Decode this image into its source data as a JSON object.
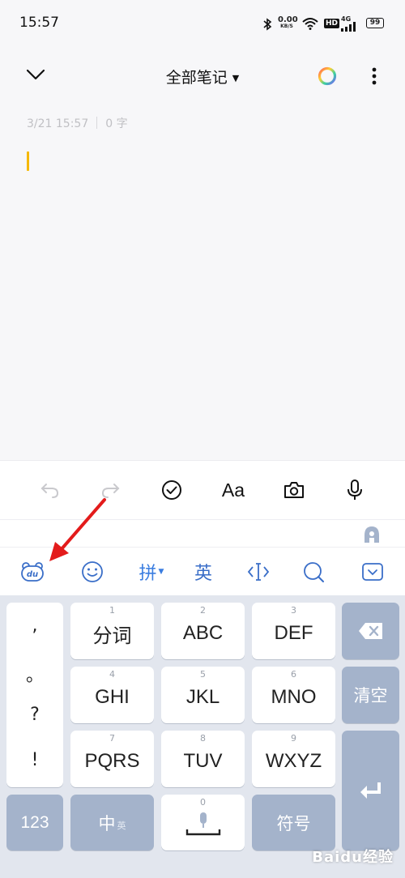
{
  "status_bar": {
    "time": "15:57",
    "net_speed_value": "0.00",
    "net_speed_unit": "KB/S",
    "hd": "HD",
    "network": "4G",
    "battery": "99"
  },
  "title_bar": {
    "title": "全部笔记",
    "icons": [
      "chevron-down-icon",
      "color-ring-icon",
      "more-vertical-icon"
    ]
  },
  "note": {
    "date": "3/21 15:57",
    "word_count": "0 字"
  },
  "toolbar": {
    "format_label": "Aa",
    "icons": [
      "undo-icon",
      "redo-icon",
      "checkbox-icon",
      "camera-icon",
      "microphone-icon"
    ]
  },
  "ime_bar": {
    "pinyin_label": "拼",
    "english_label": "英",
    "icons": [
      "baidu-du-icon",
      "emoji-icon",
      "cursor-icon",
      "search-icon",
      "hide-keyboard-icon"
    ]
  },
  "keyboard": {
    "punct": [
      ",",
      "。",
      "?",
      "!"
    ],
    "keys": [
      {
        "num": "1",
        "label": "分词"
      },
      {
        "num": "2",
        "label": "ABC"
      },
      {
        "num": "3",
        "label": "DEF"
      },
      {
        "num": "4",
        "label": "GHI"
      },
      {
        "num": "5",
        "label": "JKL"
      },
      {
        "num": "6",
        "label": "MNO"
      },
      {
        "num": "7",
        "label": "PQRS"
      },
      {
        "num": "8",
        "label": "TUV"
      },
      {
        "num": "9",
        "label": "WXYZ"
      }
    ],
    "clear_label": "清空",
    "num_key": "123",
    "zh_key": "中",
    "zh_key_sub": "英",
    "space_num": "0",
    "symbol_key": "符号"
  },
  "watermark": "Baidu经验",
  "colors": {
    "accent_blue": "#3a7de0",
    "cursor_yellow": "#f5b800",
    "arrow_red": "#e31b1b",
    "dark_key": "#a4b3cb"
  }
}
